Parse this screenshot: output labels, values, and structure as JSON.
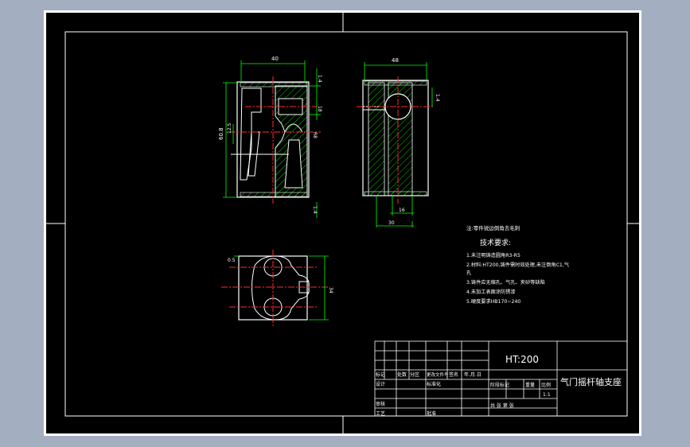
{
  "note": "注:零件锐边倒角去毛刺",
  "tech_req": {
    "title": "技术要求:",
    "items": [
      "1.未注明铸造圆角R3-R5",
      "2.材料:HT200,铸件需时效处理,未注倒角C1,气",
      "孔",
      "3.铸件应无缩孔、气孔、夹砂等缺陷",
      "4.未加工表面涂防锈漆",
      "5.硬度要求HB170~240"
    ]
  },
  "dims": {
    "front_top": "40",
    "front_right_top": "1.4",
    "front_right_mid": "18",
    "front_right_r": "R8",
    "front_left_h": "60.8",
    "front_left_small": "12.5",
    "front_right_low": "1.4",
    "side_top": "48",
    "side_right": "1.4",
    "side_bot_small": "16",
    "side_bot_big": "30",
    "top_left": "0.5",
    "top_right": "34"
  },
  "title_block": {
    "material": "HT:200",
    "part_name": "气门摇杆轴支座",
    "scale": "1:1",
    "labels": {
      "mark": "标记",
      "count": "处数",
      "zone": "分区",
      "doc_no": "更改文件号",
      "sign": "签名",
      "date": "年.月.日",
      "design": "设计",
      "std": "标准化",
      "check": "审核",
      "process": "工艺",
      "approve": "批准",
      "stage": "阶段标记",
      "weight": "重量",
      "scale_lbl": "比例",
      "sheets": "共  张  第  张"
    }
  },
  "colors": {
    "outline": "#ffffff",
    "center": "#ff2a2a",
    "dimension": "#00ff00",
    "hatch": "#00ff00"
  }
}
